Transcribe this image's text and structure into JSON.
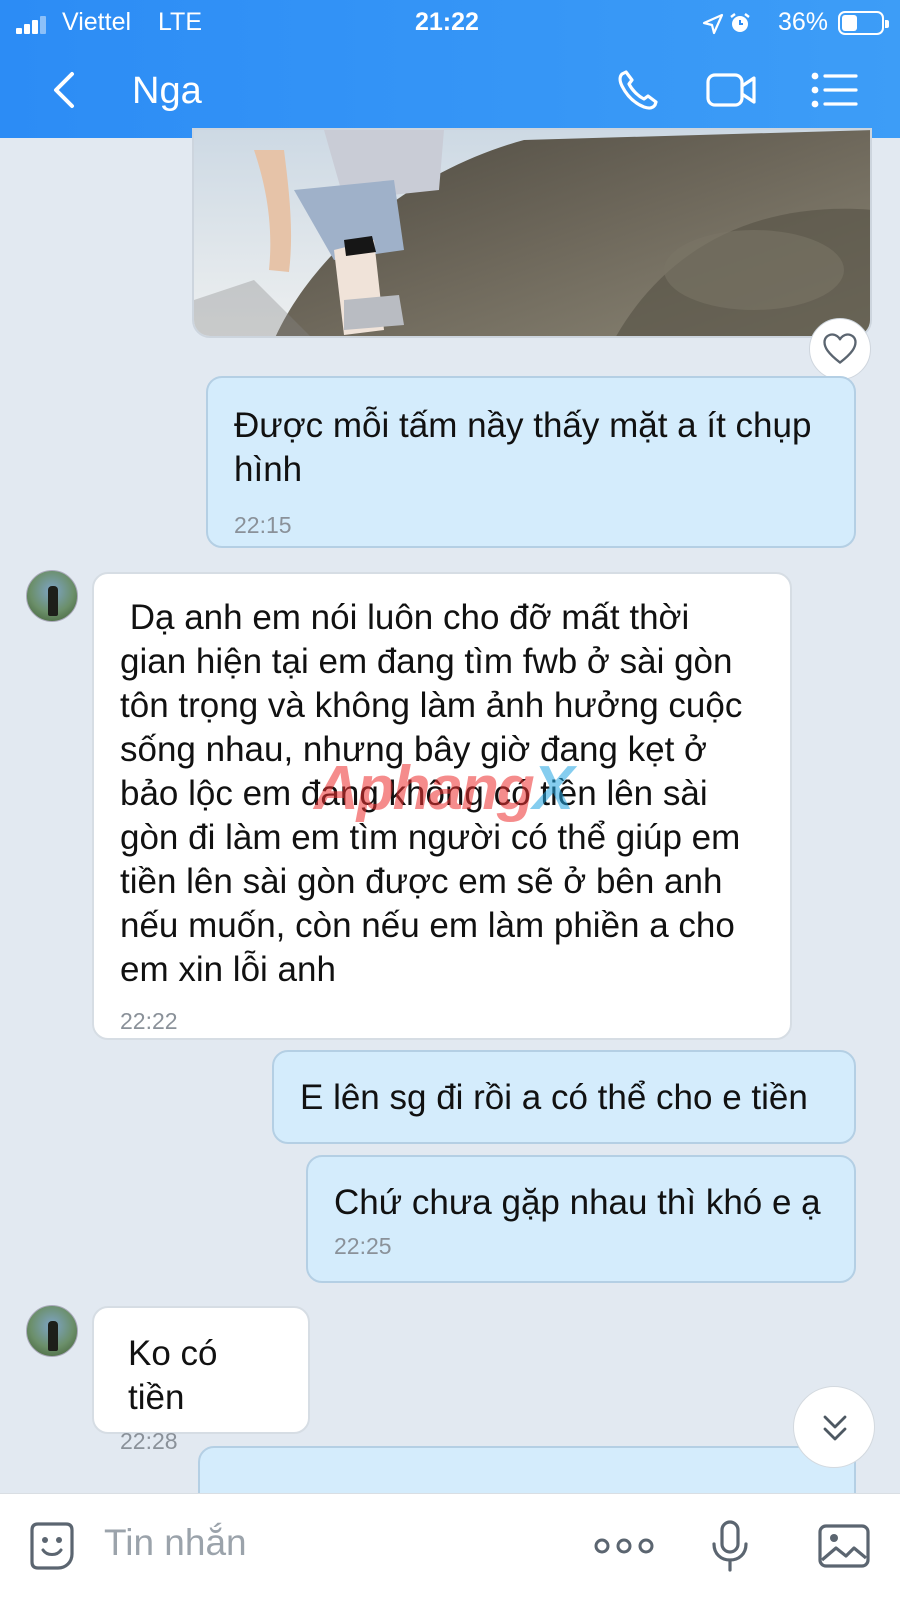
{
  "status_bar": {
    "carrier": "Viettel",
    "network": "LTE",
    "time": "21:22",
    "battery_percent": "36%",
    "battery_level": 0.36,
    "signal_bars": 3
  },
  "header": {
    "back_icon": "chevron-left-icon",
    "contact_name": "Nga",
    "call_icon": "phone-icon",
    "video_icon": "video-camera-icon",
    "menu_icon": "list-menu-icon"
  },
  "messages": [
    {
      "type": "image",
      "direction": "out",
      "reaction_icon": "heart-icon"
    },
    {
      "type": "text",
      "direction": "out",
      "text": "Được mỗi tấm nầy thấy mặt a ít chụp hình",
      "time": "22:15"
    },
    {
      "type": "text",
      "direction": "in",
      "text": " Dạ anh em nói luôn cho đỡ mất thời gian hiện tại em đang tìm fwb ở sài gòn tôn trọng và không làm ảnh hưởng cuộc sống nhau, nhưng bây giờ đang kẹt ở bảo lộc em đang không có tiền lên sài gòn đi làm em tìm người có thể giúp em tiền lên sài gòn được em sẽ ở bên anh nếu muốn, còn nếu em làm phiền a cho em xin lỗi anh",
      "time": "22:22"
    },
    {
      "type": "text",
      "direction": "out",
      "text": "E lên sg đi rồi a có thể cho e tiền",
      "time": ""
    },
    {
      "type": "text",
      "direction": "out",
      "text": "Chứ chưa gặp nhau thì khó e ạ",
      "time": "22:25"
    },
    {
      "type": "text",
      "direction": "in",
      "text": "Ko có tiền",
      "time": "22:28"
    }
  ],
  "watermark": {
    "part1": "Aphang",
    "part2": "X"
  },
  "input_bar": {
    "placeholder": "Tin nhắn",
    "emoji_icon": "sticker-icon",
    "more_icon": "more-dots-icon",
    "mic_icon": "microphone-icon",
    "gallery_icon": "image-gallery-icon"
  },
  "colors": {
    "header": "#2c8cf5",
    "outgoing_bubble": "#d4ecfc",
    "incoming_bubble": "#ffffff",
    "background": "#e2e9f1"
  }
}
